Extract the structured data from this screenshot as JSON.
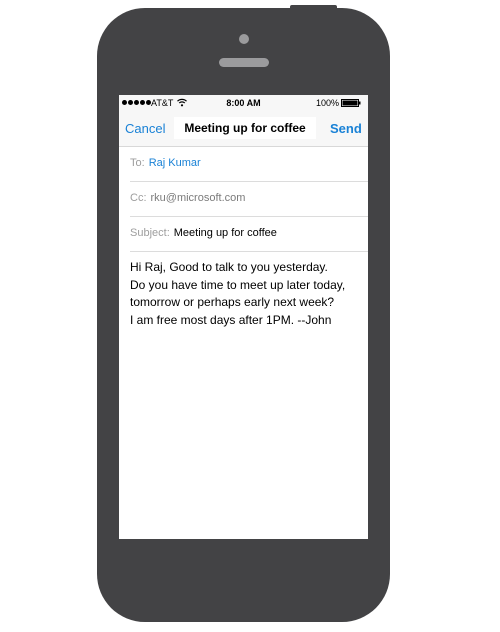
{
  "status_bar": {
    "carrier": "AT&T",
    "time": "8:00 AM",
    "battery_percent": "100%",
    "signal_dots": 5,
    "battery_level": 1.0
  },
  "nav": {
    "cancel_label": "Cancel",
    "title": "Meeting up for coffee",
    "send_label": "Send"
  },
  "fields": {
    "to_label": "To:",
    "to_value": "Raj Kumar",
    "cc_label": "Cc:",
    "cc_value": "rku@microsoft.com",
    "subject_label": "Subject:",
    "subject_value": "Meeting up for coffee"
  },
  "body": {
    "lines": [
      "Hi Raj, Good to talk to you yesterday.",
      "Do you have time to meet up later today,",
      "tomorrow or perhaps early next week?",
      "I am free most days after 1PM. --John"
    ]
  },
  "colors": {
    "accent": "#1a82d6",
    "phone_body": "#434345",
    "phone_detail": "#9b9b9d"
  },
  "icons": {
    "wifi": "wifi-icon",
    "battery": "battery-icon",
    "signal": "signal-icon"
  }
}
